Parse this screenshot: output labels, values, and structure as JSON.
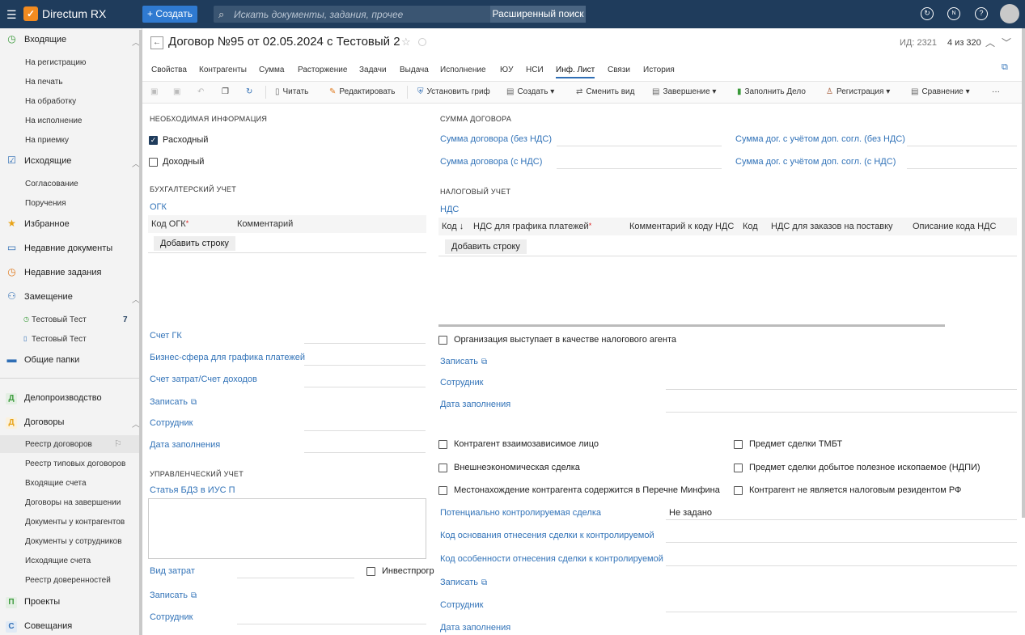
{
  "topbar": {
    "app_name": "Directum RX",
    "create_label": "Создать",
    "search_placeholder": "Искать документы, задания, прочее",
    "advanced_search_label": "Расширенный поиск"
  },
  "sidebar": {
    "incoming": "Входящие",
    "incoming_items": [
      "На регистрацию",
      "На печать",
      "На обработку",
      "На исполнение",
      "На приемку"
    ],
    "outgoing": "Исходящие",
    "outgoing_items": [
      "Согласование",
      "Поручения"
    ],
    "favorites": "Избранное",
    "recent_docs": "Недавние документы",
    "recent_tasks": "Недавние задания",
    "substitution": "Замещение",
    "substitution_items": [
      {
        "label": "Тестовый Тест",
        "count": "7"
      },
      {
        "label": "Тестовый Тест",
        "count": ""
      }
    ],
    "shared_folders": "Общие папки",
    "records": "Делопроизводство",
    "records_letter": "Д",
    "contracts": "Договоры",
    "contracts_letter": "Д",
    "contracts_items": [
      "Реестр договоров",
      "Реестр типовых договоров",
      "Входящие счета",
      "Договоры на завершении",
      "Документы у контрагентов",
      "Документы у сотрудников",
      "Исходящие счета",
      "Реестр доверенностей"
    ],
    "projects": "Проекты",
    "projects_letter": "П",
    "meetings": "Совещания",
    "meetings_letter": "С"
  },
  "document": {
    "title": "Договор №95 от 02.05.2024 с Тестовый 2",
    "id_label": "ИД: 2321",
    "pager": "4 из 320"
  },
  "tabs": [
    "Свойства",
    "Контрагенты",
    "Сумма",
    "Расторжение",
    "Задачи",
    "Выдача",
    "Исполнение",
    "ЮУ",
    "НСИ",
    "Инф. Лист",
    "Связи",
    "История"
  ],
  "toolbar": {
    "read": "Читать",
    "edit": "Редактировать",
    "set_stamp": "Установить гриф",
    "create": "Создать",
    "change_type": "Сменить вид",
    "completion": "Завершение",
    "fill_case": "Заполнить Дело",
    "registration": "Регистрация",
    "compare": "Сравнение",
    "more": "···"
  },
  "left": {
    "required_info": "НЕОБХОДИМАЯ ИНФОРМАЦИЯ",
    "expense": "Расходный",
    "income": "Доходный",
    "accounting": "БУХГАЛТЕРСКИЙ УЧЕТ",
    "ogk": "ОГК",
    "ogk_code": "Код ОГК",
    "comment": "Комментарий",
    "add_row": "Добавить строку",
    "gl_account": "Счет ГК",
    "business_sphere": "Бизнес-сфера для графика платежей",
    "cost_account": "Счет затрат/Счет доходов",
    "record": "Записать",
    "employee": "Сотрудник",
    "fill_date": "Дата заполнения",
    "management": "УПРАВЛЕНЧЕСКИЙ УЧЕТ",
    "bdz_article": "Статья БДЗ в ИУС П",
    "cost_type": "Вид затрат",
    "invest": "Инвестпрогр",
    "record2": "Записать",
    "employee2": "Сотрудник"
  },
  "right": {
    "contract_sum": "СУММА ДОГОВОРА",
    "sum_no_vat": "Сумма договора (без НДС)",
    "sum_vat": "Сумма договора (с НДС)",
    "sum_add_no_vat": "Сумма дог. с учётом доп. согл. (без НДС)",
    "sum_add_vat": "Сумма дог. с учётом доп. согл. (с НДС)",
    "tax": "НАЛОГОВЫЙ УЧЕТ",
    "vat": "НДС",
    "col_code": "Код",
    "col_vat_schedule": "НДС для графика платежей",
    "col_comment_vat": "Комментарий к коду НДС",
    "col_code2": "Код",
    "col_vat_orders": "НДС для заказов на поставку",
    "col_desc": "Описание кода НДС",
    "add_row": "Добавить строку",
    "tax_agent": "Организация выступает в качестве налогового агента",
    "record": "Записать",
    "employee": "Сотрудник",
    "fill_date": "Дата заполнения",
    "interdependent": "Контрагент взаимозависимое лицо",
    "foreign_trade": "Внешнеэкономическая сделка",
    "minfin_list": "Местонахождение контрагента содержится в Перечне Минфина",
    "tmbt": "Предмет сделки ТМБТ",
    "ndpi": "Предмет сделки добытое полезное ископаемое (НДПИ)",
    "non_resident": "Контрагент не является налоговым резидентом РФ",
    "controlled": "Потенциально контролируемая сделка",
    "controlled_value": "Не задано",
    "ctrl_basis_code": "Код основания отнесения сделки к контролируемой",
    "ctrl_feature_code": "Код особенности отнесения сделки к контролируемой",
    "record2": "Записать",
    "employee2": "Сотрудник",
    "fill_date2": "Дата заполнения"
  }
}
